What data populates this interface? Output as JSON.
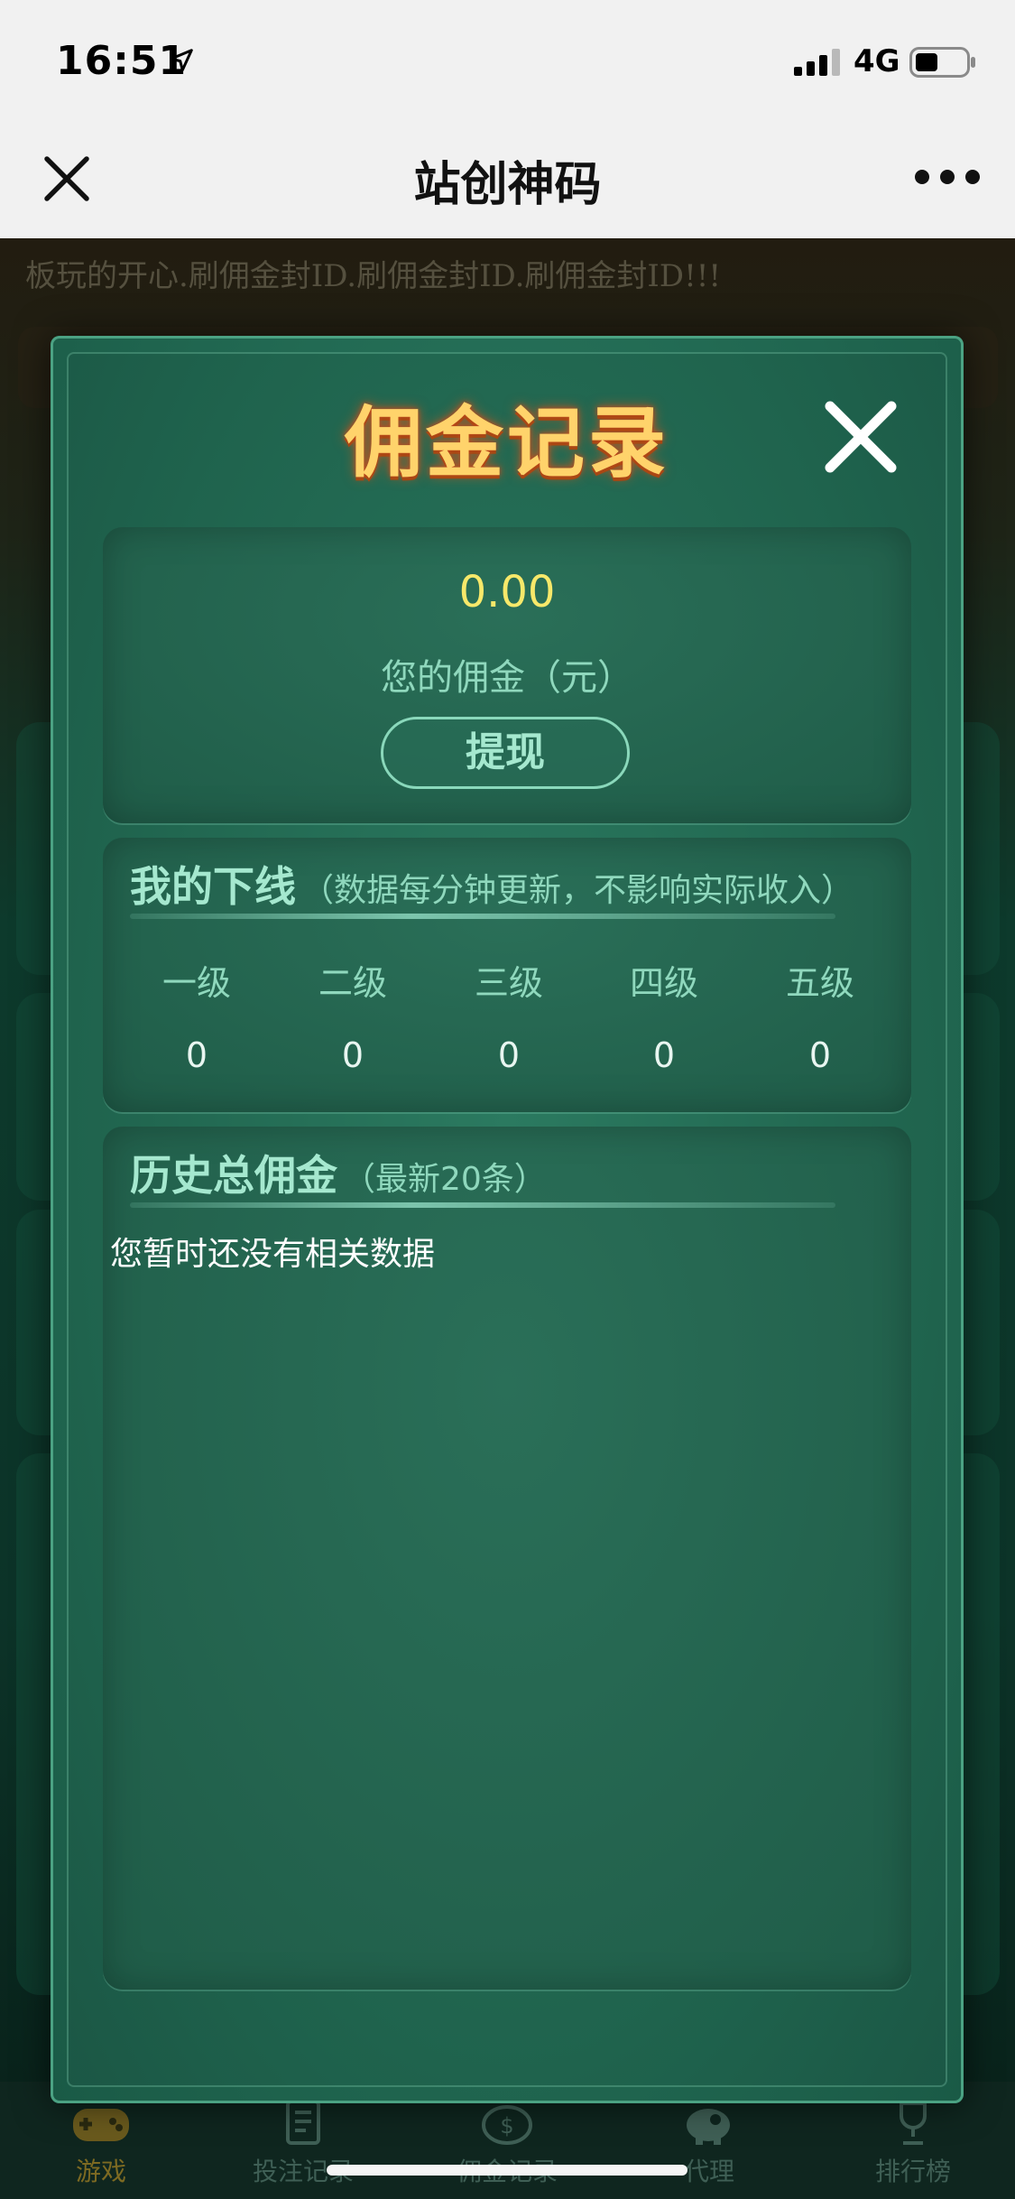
{
  "status_bar": {
    "time": "16:51",
    "network": "4G"
  },
  "nav": {
    "title": "站创神码"
  },
  "marquee": "板玩的开心.刷佣金封ID.刷佣金封ID.刷佣金封ID!!!",
  "modal": {
    "title": "佣金记录",
    "balance": {
      "value": "0.00",
      "label": "您的佣金（元）",
      "withdraw_label": "提现"
    },
    "downline": {
      "title": "我的下线",
      "note": "（数据每分钟更新，不影响实际收入）",
      "levels": [
        {
          "name": "一级",
          "count": "0"
        },
        {
          "name": "二级",
          "count": "0"
        },
        {
          "name": "三级",
          "count": "0"
        },
        {
          "name": "四级",
          "count": "0"
        },
        {
          "name": "五级",
          "count": "0"
        }
      ]
    },
    "history": {
      "title": "历史总佣金",
      "note": "（最新20条）",
      "empty_text": "您暂时还没有相关数据"
    }
  },
  "tabs": [
    {
      "label": "游戏",
      "icon": "gamepad-icon"
    },
    {
      "label": "投注记录",
      "icon": "betting-record-icon"
    },
    {
      "label": "佣金记录",
      "icon": "commission-coin-icon"
    },
    {
      "label": "代理",
      "icon": "agent-piggy-icon"
    },
    {
      "label": "排行榜",
      "icon": "trophy-icon"
    }
  ],
  "colors": {
    "accent_gold": "#ffd36b",
    "balance_yellow": "#f7e86a",
    "mint_text": "#8fd8bd",
    "modal_green": "#226a53"
  }
}
